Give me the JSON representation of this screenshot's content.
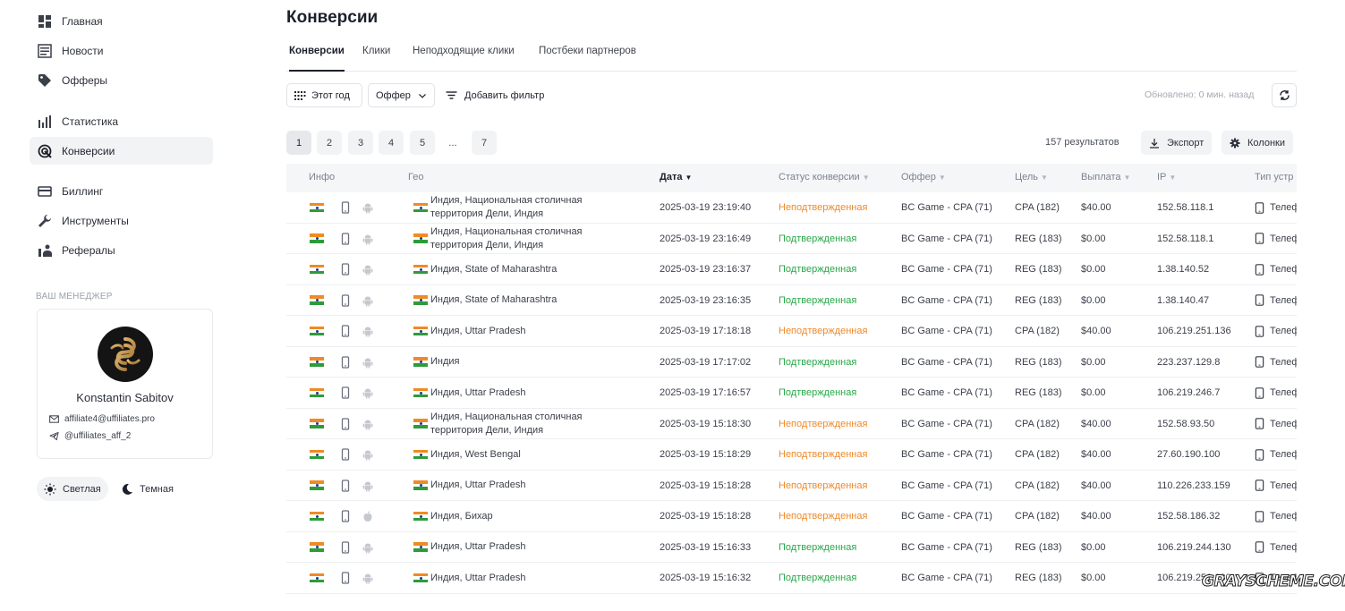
{
  "sidebar": {
    "items": [
      {
        "label": "Главная",
        "icon": "dashboard-icon"
      },
      {
        "label": "Новости",
        "icon": "news-icon"
      },
      {
        "label": "Офферы",
        "icon": "tag-icon"
      },
      {
        "label": "Статистика",
        "icon": "bar-chart-icon"
      },
      {
        "label": "Конверсии",
        "icon": "conversion-icon",
        "active": true
      },
      {
        "label": "Биллинг",
        "icon": "credit-card-icon"
      },
      {
        "label": "Инструменты",
        "icon": "wrench-icon"
      },
      {
        "label": "Рефералы",
        "icon": "referral-icon"
      }
    ],
    "manager": {
      "title": "ВАШ МЕНЕДЖЕР",
      "name": "Konstantin Sabitov",
      "email": "affiliate4@uffiliates.pro",
      "telegram": "@uffiliates_aff_2"
    },
    "theme": {
      "light_label": "Светлая",
      "dark_label": "Темная",
      "selected": "light"
    }
  },
  "main": {
    "title": "Конверсии",
    "tabs": [
      {
        "label": "Конверсии",
        "active": true
      },
      {
        "label": "Клики"
      },
      {
        "label": "Неподходящие клики"
      },
      {
        "label": "Постбеки партнеров"
      }
    ],
    "toolbar": {
      "period_label": "Этот год",
      "offer_label": "Оффер",
      "add_filter_label": "Добавить фильтр",
      "updated_text": "Обновлено: 0 мин. назад"
    },
    "pagination": {
      "pages": [
        "1",
        "2",
        "3",
        "4",
        "5",
        "...",
        "7"
      ],
      "current": "1",
      "results_text": "157  результатов",
      "export_label": "Экспорт",
      "columns_label": "Колонки"
    },
    "table": {
      "columns": [
        "Инфо",
        "Гео",
        "Дата",
        "Статус конверсии",
        "Оффер",
        "Цель",
        "Выплата",
        "IP",
        "Тип устр"
      ],
      "sorted_column": "Дата",
      "rows": [
        {
          "os": "android",
          "geo": "Индия, Национальная столичная территория Дели, Индия",
          "date": "2025-03-19 23:19:40",
          "status": "Неподтвержденная",
          "status_type": "pending",
          "offer": "BC Game - CPA (71)",
          "goal": "CPA (182)",
          "payout": "$40.00",
          "ip": "152.58.118.1",
          "device": "Телеф"
        },
        {
          "os": "android",
          "geo": "Индия, Национальная столичная территория Дели, Индия",
          "date": "2025-03-19 23:16:49",
          "status": "Подтвержденная",
          "status_type": "ok",
          "offer": "BC Game - CPA (71)",
          "goal": "REG (183)",
          "payout": "$0.00",
          "ip": "152.58.118.1",
          "device": "Телеф"
        },
        {
          "os": "android",
          "geo": "Индия, State of Maharashtra",
          "date": "2025-03-19 23:16:37",
          "status": "Подтвержденная",
          "status_type": "ok",
          "offer": "BC Game - CPA (71)",
          "goal": "REG (183)",
          "payout": "$0.00",
          "ip": "1.38.140.52",
          "device": "Телеф"
        },
        {
          "os": "android",
          "geo": "Индия, State of Maharashtra",
          "date": "2025-03-19 23:16:35",
          "status": "Подтвержденная",
          "status_type": "ok",
          "offer": "BC Game - CPA (71)",
          "goal": "REG (183)",
          "payout": "$0.00",
          "ip": "1.38.140.47",
          "device": "Телеф"
        },
        {
          "os": "android",
          "geo": "Индия, Uttar Pradesh",
          "date": "2025-03-19 17:18:18",
          "status": "Неподтвержденная",
          "status_type": "pending",
          "offer": "BC Game - CPA (71)",
          "goal": "CPA (182)",
          "payout": "$40.00",
          "ip": "106.219.251.136",
          "device": "Телеф"
        },
        {
          "os": "android",
          "geo": "Индия",
          "date": "2025-03-19 17:17:02",
          "status": "Подтвержденная",
          "status_type": "ok",
          "offer": "BC Game - CPA (71)",
          "goal": "REG (183)",
          "payout": "$0.00",
          "ip": "223.237.129.8",
          "device": "Телеф"
        },
        {
          "os": "android",
          "geo": "Индия, Uttar Pradesh",
          "date": "2025-03-19 17:16:57",
          "status": "Подтвержденная",
          "status_type": "ok",
          "offer": "BC Game - CPA (71)",
          "goal": "REG (183)",
          "payout": "$0.00",
          "ip": "106.219.246.7",
          "device": "Телеф"
        },
        {
          "os": "android",
          "geo": "Индия, Национальная столичная территория Дели, Индия",
          "date": "2025-03-19 15:18:30",
          "status": "Неподтвержденная",
          "status_type": "pending",
          "offer": "BC Game - CPA (71)",
          "goal": "CPA (182)",
          "payout": "$40.00",
          "ip": "152.58.93.50",
          "device": "Телеф"
        },
        {
          "os": "android",
          "geo": "Индия, West Bengal",
          "date": "2025-03-19 15:18:29",
          "status": "Неподтвержденная",
          "status_type": "pending",
          "offer": "BC Game - CPA (71)",
          "goal": "CPA (182)",
          "payout": "$40.00",
          "ip": "27.60.190.100",
          "device": "Телеф"
        },
        {
          "os": "android",
          "geo": "Индия, Uttar Pradesh",
          "date": "2025-03-19 15:18:28",
          "status": "Неподтвержденная",
          "status_type": "pending",
          "offer": "BC Game - CPA (71)",
          "goal": "CPA (182)",
          "payout": "$40.00",
          "ip": "110.226.233.159",
          "device": "Телеф"
        },
        {
          "os": "apple",
          "geo": "Индия, Бихар",
          "date": "2025-03-19 15:18:28",
          "status": "Неподтвержденная",
          "status_type": "pending",
          "offer": "BC Game - CPA (71)",
          "goal": "CPA (182)",
          "payout": "$40.00",
          "ip": "152.58.186.32",
          "device": "Телеф"
        },
        {
          "os": "android",
          "geo": "Индия, Uttar Pradesh",
          "date": "2025-03-19 15:16:33",
          "status": "Подтвержденная",
          "status_type": "ok",
          "offer": "BC Game - CPA (71)",
          "goal": "REG (183)",
          "payout": "$0.00",
          "ip": "106.219.244.130",
          "device": "Телеф"
        },
        {
          "os": "android",
          "geo": "Индия, Uttar Pradesh",
          "date": "2025-03-19 15:16:32",
          "status": "Подтвержденная",
          "status_type": "ok",
          "offer": "BC Game - CPA (71)",
          "goal": "REG (183)",
          "payout": "$0.00",
          "ip": "106.219.251.130",
          "device": "Телеф"
        }
      ]
    }
  },
  "watermark": "GRAYSCHEME.COM",
  "colors": {
    "pending": "#ef8a2b",
    "confirmed": "#2aa84a",
    "accent": "#1c202b",
    "muted": "#9aa0ab"
  }
}
